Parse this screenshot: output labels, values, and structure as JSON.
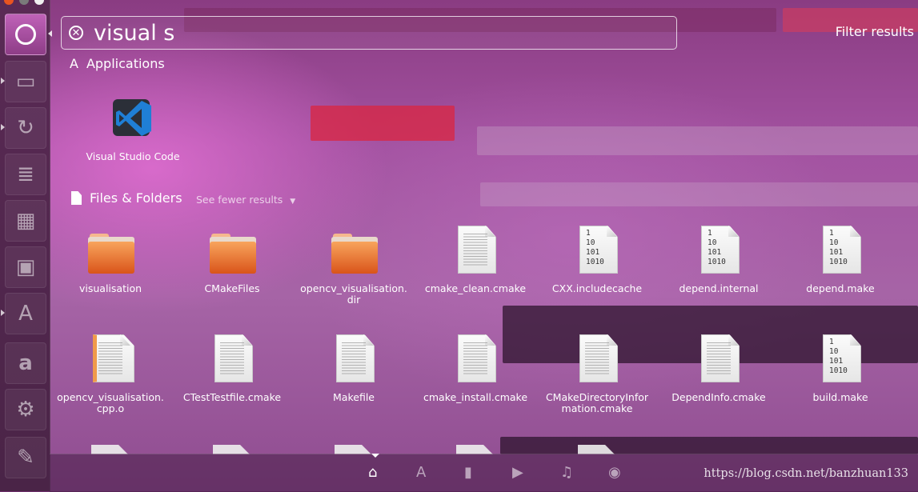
{
  "search": {
    "value": "visual s",
    "filter_label": "Filter results"
  },
  "sections": {
    "applications": {
      "title": "Applications"
    },
    "files": {
      "title": "Files & Folders",
      "fewer_label": "See fewer results"
    }
  },
  "applications": [
    {
      "label": "Visual Studio Code",
      "icon": "vscode-icon"
    }
  ],
  "files": [
    {
      "label": "visualisation",
      "type": "folder"
    },
    {
      "label": "CMakeFiles",
      "type": "folder"
    },
    {
      "label": "opencv_visualisation.dir",
      "type": "folder"
    },
    {
      "label": "cmake_clean.cmake",
      "type": "text"
    },
    {
      "label": "CXX.includecache",
      "type": "binary"
    },
    {
      "label": "depend.internal",
      "type": "binary"
    },
    {
      "label": "depend.make",
      "type": "binary"
    },
    {
      "label": "opencv_visualisation.cpp.o",
      "type": "object"
    },
    {
      "label": "CTestTestfile.cmake",
      "type": "text"
    },
    {
      "label": "Makefile",
      "type": "text"
    },
    {
      "label": "cmake_install.cmake",
      "type": "text"
    },
    {
      "label": "CMakeDirectoryInformation.cmake",
      "type": "text"
    },
    {
      "label": "DependInfo.cmake",
      "type": "text"
    },
    {
      "label": "build.make",
      "type": "binary"
    }
  ],
  "binary_glyph": [
    "1",
    "10",
    "101",
    "1010"
  ],
  "lenses": [
    {
      "name": "home-lens",
      "glyph": "⌂",
      "active": true
    },
    {
      "name": "applications-lens",
      "glyph": "A",
      "active": false
    },
    {
      "name": "files-lens",
      "glyph": "▮",
      "active": false
    },
    {
      "name": "video-lens",
      "glyph": "▶",
      "active": false
    },
    {
      "name": "music-lens",
      "glyph": "♫",
      "active": false
    },
    {
      "name": "photo-lens",
      "glyph": "◉",
      "active": false
    }
  ],
  "watermark": "https://blog.csdn.net/banzhuan133",
  "colors": {
    "launcher": "#4f2649",
    "accent": "#a352a1",
    "folder": "#e8742e"
  }
}
